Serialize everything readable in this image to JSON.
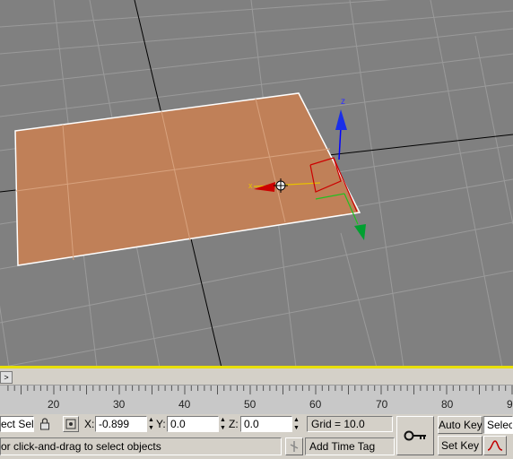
{
  "viewport": {
    "gizmo": {
      "z_axis_label": "z",
      "x_axis_label": "x"
    }
  },
  "timeline": {
    "slider_arrow": ">",
    "ruler_labels": [
      "20",
      "30",
      "40",
      "50",
      "60",
      "70",
      "80",
      "9"
    ]
  },
  "status": {
    "selection_mode": "ect Sele",
    "x_label": "X:",
    "x_value": "-0.899",
    "y_label": "Y:",
    "y_value": "0.0",
    "z_label": "Z:",
    "z_value": "0.0",
    "grid": "Grid = 10.0",
    "prompt": "or click-and-drag to select objects",
    "add_time_tag": "Add Time Tag",
    "auto_key": "Auto Key",
    "set_key": "Set Key",
    "selected": "Selec"
  },
  "colors": {
    "viewport_bg": "#808080",
    "plane_fill": "#c08058",
    "active_border": "#e8e000",
    "panel_bg": "#d4d0c8"
  }
}
